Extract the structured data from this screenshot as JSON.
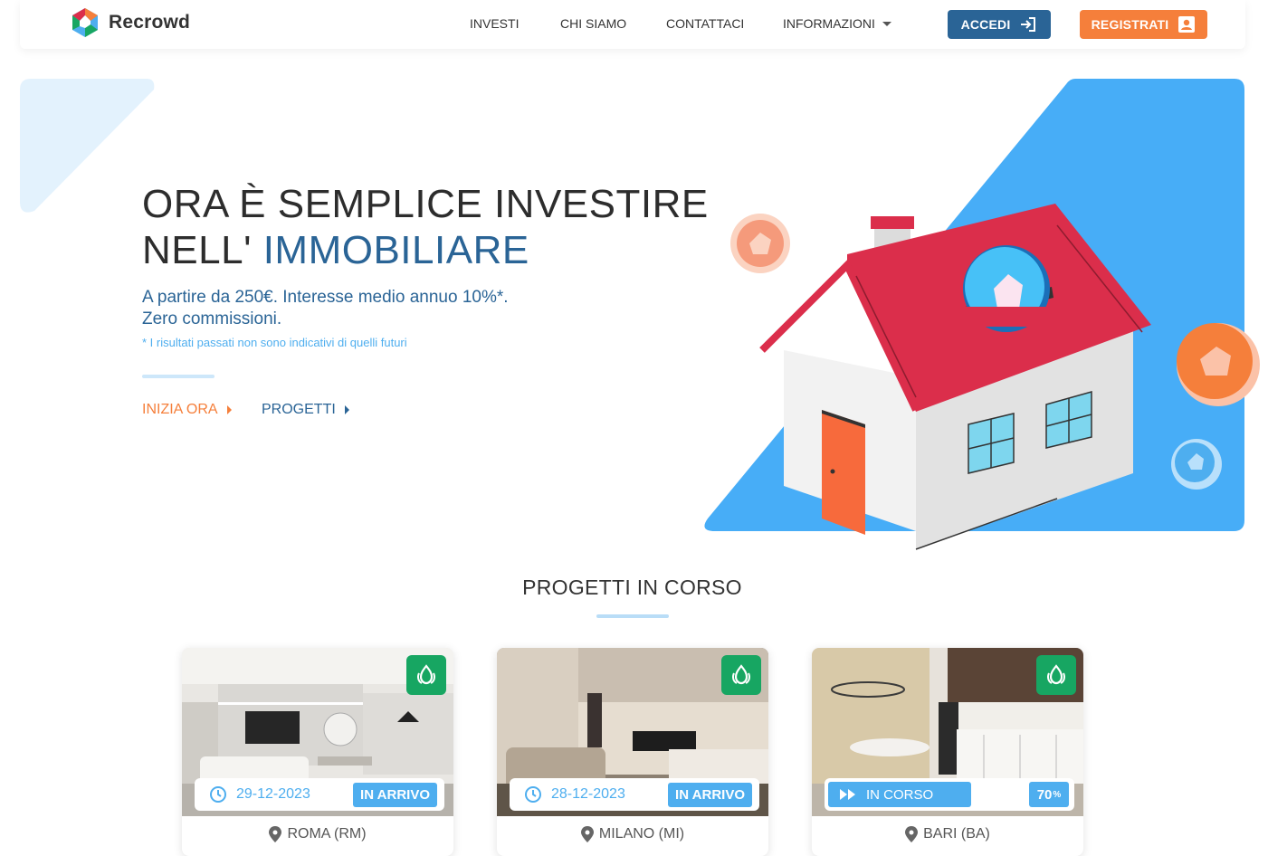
{
  "brand": {
    "name": "Recrowd"
  },
  "nav": {
    "items": [
      {
        "label": "INVESTI"
      },
      {
        "label": "CHI SIAMO"
      },
      {
        "label": "CONTATTACI"
      },
      {
        "label": "INFORMAZIONI"
      }
    ],
    "login_label": "ACCEDI",
    "register_label": "REGISTRATI"
  },
  "hero": {
    "title_line1": "ORA È SEMPLICE INVESTIRE",
    "title_line2_prefix": "NELL' ",
    "title_line2_accent": "IMMOBILIARE",
    "subtitle_line1": "A partire da 250€. Interesse medio annuo 10%*.",
    "subtitle_line2": "Zero commissioni.",
    "note": "* I risultati passati non sono indicativi di quelli futuri",
    "cta_start": "INIZIA ORA",
    "cta_projects": "PROGETTI"
  },
  "projects_section": {
    "title": "PROGETTI IN CORSO",
    "cards": [
      {
        "date": "29-12-2023",
        "status": "IN ARRIVO",
        "location": "ROMA (RM)"
      },
      {
        "date": "28-12-2023",
        "status": "IN ARRIVO",
        "location": "MILANO (MI)"
      },
      {
        "status": "IN CORSO",
        "progress_percent": "70",
        "progress_unit": "%",
        "location": "BARI (BA)"
      }
    ]
  },
  "colors": {
    "primary": "#2a6496",
    "accent_orange": "#f57f3b",
    "light_blue": "#4eaeef",
    "hero_blue": "#47adf7",
    "eco_green": "#17a662",
    "roof_red": "#db2e4b"
  },
  "icons": {
    "login": "login-arrow-icon",
    "register": "user-card-icon",
    "eco": "leaf-drop-icon",
    "date": "clock-icon",
    "running": "fast-forward-icon",
    "location": "map-pin-icon"
  }
}
